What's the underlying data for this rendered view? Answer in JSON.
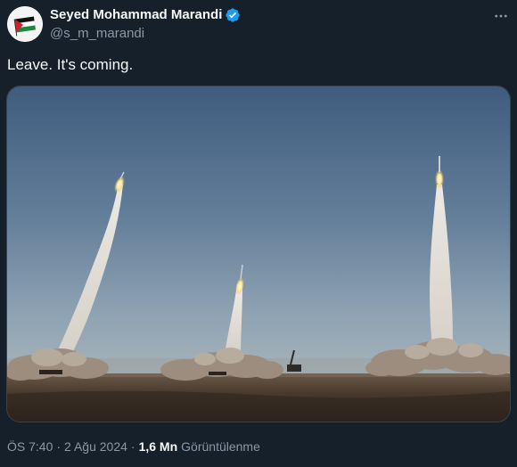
{
  "author": {
    "display_name": "Seyed Mohammad Marandi",
    "handle": "@s_m_marandi",
    "verified_icon": "verified-badge-icon",
    "avatar_icon": "palestine-flag-avatar"
  },
  "tweet": {
    "text": "Leave. It's coming."
  },
  "media": {
    "image": "missile-launch-photo"
  },
  "meta": {
    "time": "ÖS 7:40",
    "separator": "·",
    "date": "2 Ağu 2024",
    "views_count": "1,6 Mn",
    "views_label": "Görüntülenme"
  },
  "colors": {
    "background": "#15202b",
    "text_primary": "#f7f9f9",
    "text_secondary": "#8b98a5",
    "verified": "#1d9bf0",
    "border": "#38444d"
  }
}
